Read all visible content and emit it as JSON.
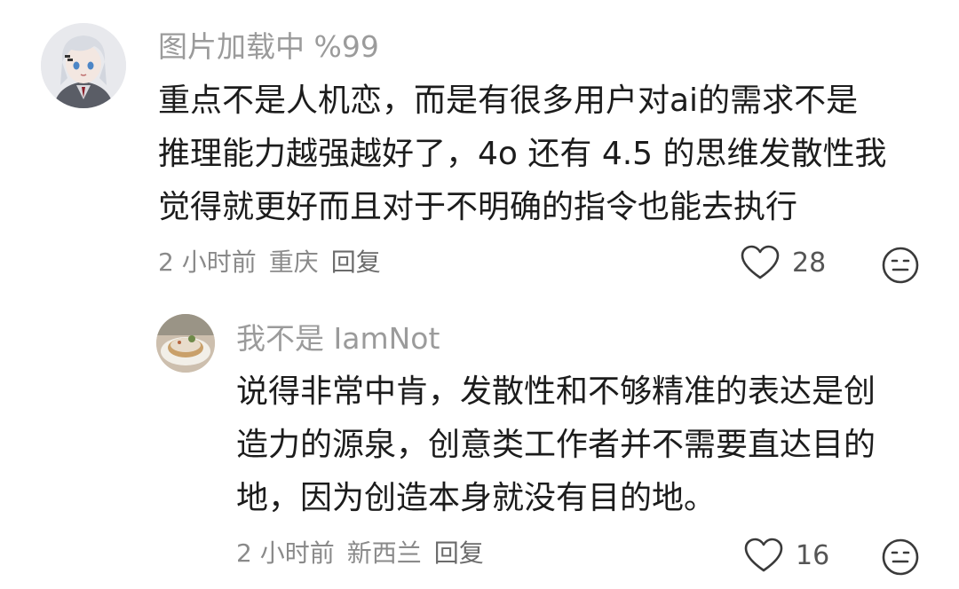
{
  "comments": [
    {
      "username": "图片加载中 %99",
      "content_lines": [
        "重点不是人机恋，而是有很多用户对ai的需求不是",
        "推理能力越强越好了，4o 还有 4.5 的思维发散性我",
        "觉得就更好而且对于不明确的指令也能去执行"
      ],
      "time": "2 小时前",
      "location": "重庆",
      "reply_label": "回复",
      "likes": "28"
    },
    {
      "username": "我不是 IamNot",
      "content_lines": [
        "说得非常中肯，发散性和不够精准的表达是创",
        "造力的源泉，创意类工作者并不需要直达目的",
        "地，因为创造本身就没有目的地。"
      ],
      "time": "2 小时前",
      "location": "新西兰",
      "reply_label": "回复",
      "likes": "16"
    }
  ],
  "icons": {
    "like": "heart-outline-icon",
    "reaction": "neutral-face-icon"
  }
}
